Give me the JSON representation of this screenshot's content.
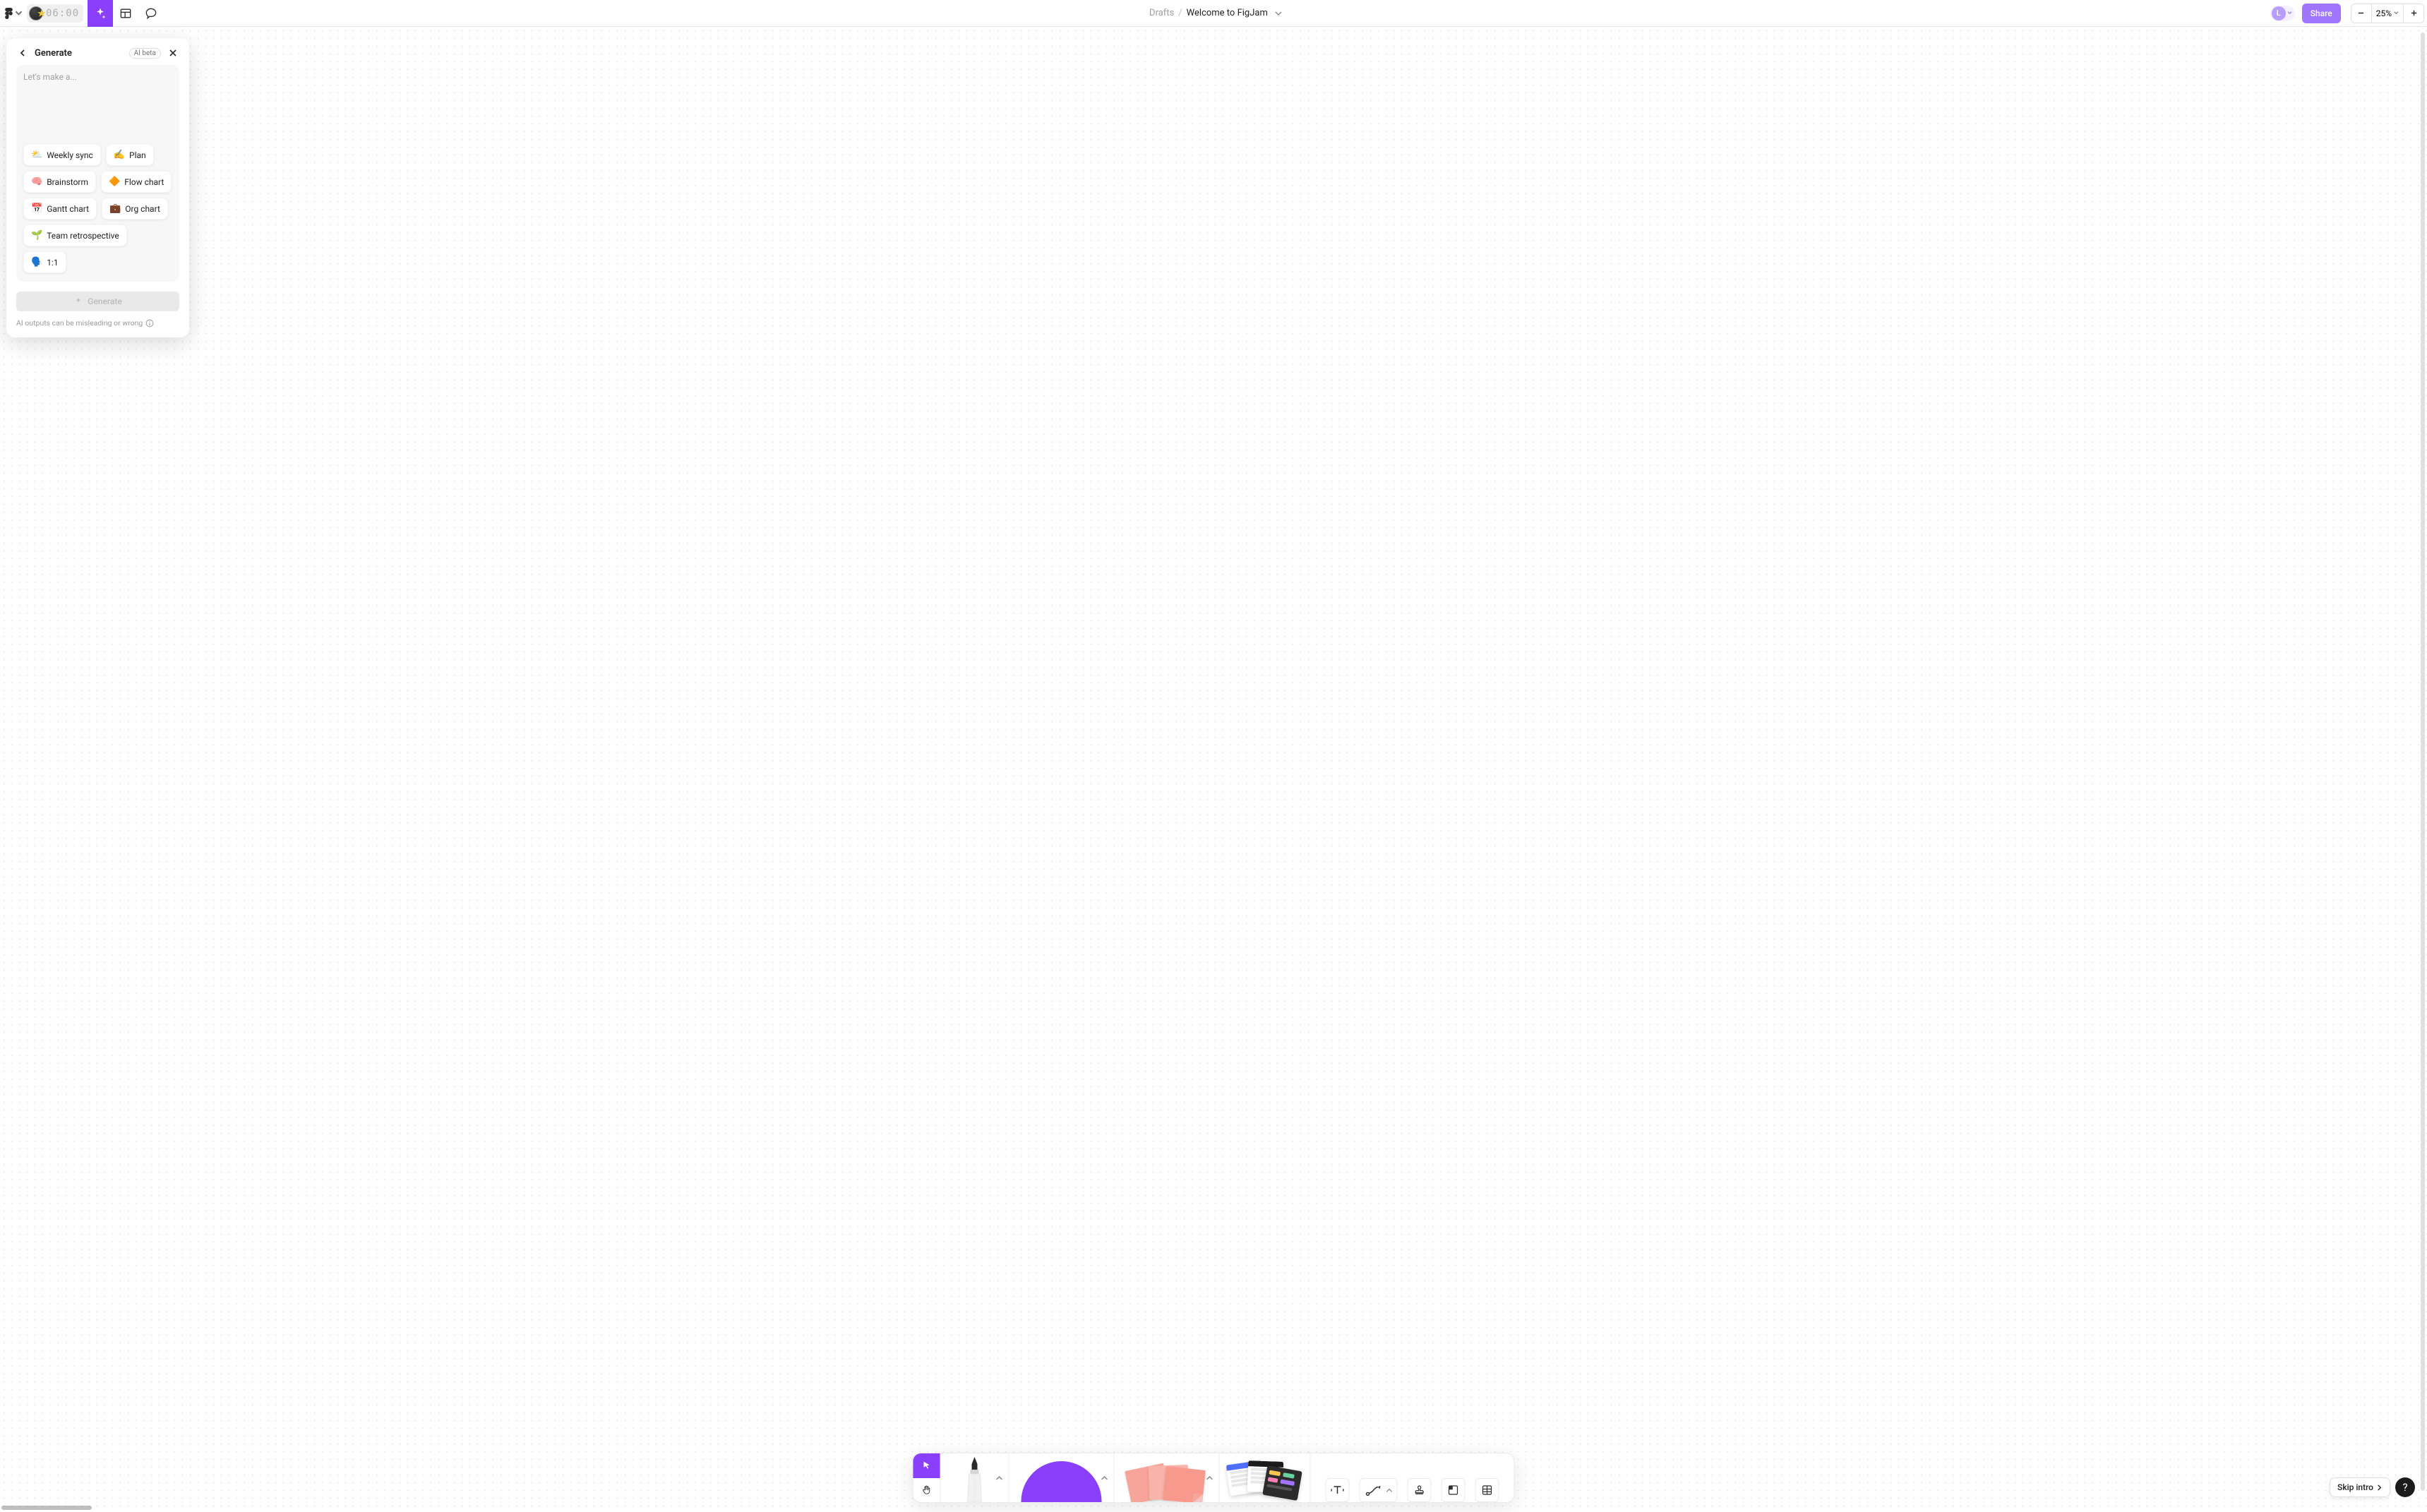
{
  "topbar": {
    "timer": "06:00",
    "breadcrumb": "Drafts",
    "filename": "Welcome to FigJam",
    "avatar_initial": "L",
    "share_label": "Share",
    "zoom": "25%"
  },
  "generate": {
    "title": "Generate",
    "badge": "AI beta",
    "placeholder": "Let's make a...",
    "chips": [
      {
        "emoji": "⛅",
        "label": "Weekly sync"
      },
      {
        "emoji": "✍️",
        "label": "Plan"
      },
      {
        "emoji": "🧠",
        "label": "Brainstorm"
      },
      {
        "emoji": "🔶",
        "label": "Flow chart"
      },
      {
        "emoji": "📅",
        "label": "Gantt chart"
      },
      {
        "emoji": "💼",
        "label": "Org chart"
      },
      {
        "emoji": "🌱",
        "label": "Team retrospective"
      },
      {
        "emoji": "🗣️",
        "label": "1:1"
      }
    ],
    "submit_label": "Generate",
    "footer": "AI outputs can be misleading or wrong"
  },
  "corner": {
    "skip_label": "Skip intro",
    "help_label": "?"
  }
}
